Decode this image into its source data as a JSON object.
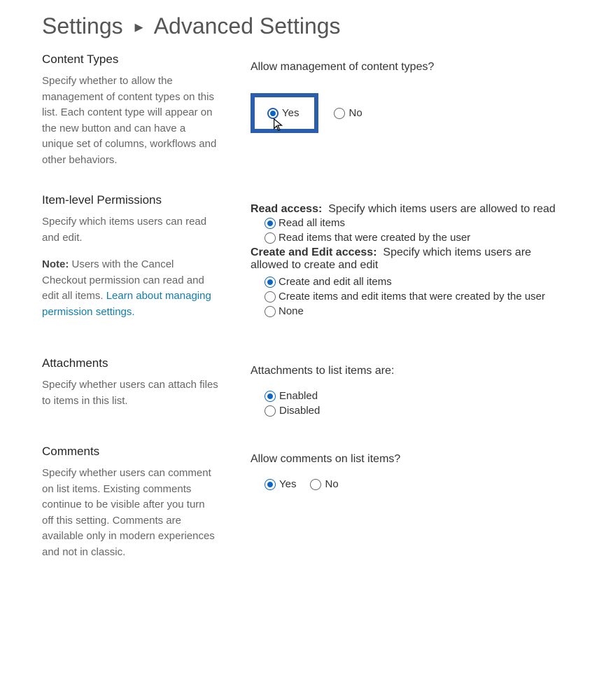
{
  "breadcrumb": {
    "root": "Settings",
    "current": "Advanced Settings"
  },
  "sections": {
    "content_types": {
      "title": "Content Types",
      "desc": "Specify whether to allow the management of content types on this list. Each content type will appear on the new button and can have a unique set of columns, workflows and other behaviors.",
      "question": "Allow management of content types?",
      "opt_yes": "Yes",
      "opt_no": "No"
    },
    "item_level": {
      "title": "Item-level Permissions",
      "desc_main": "Specify which items users can read and edit.",
      "note_label": "Note:",
      "note_text": " Users with the Cancel Checkout permission can read and edit all items. ",
      "link": "Learn about managing permission settings.",
      "read_label": "Read access:",
      "read_hint": "Specify which items users are allowed to read",
      "read_opt1": "Read all items",
      "read_opt2": "Read items that were created by the user",
      "edit_label": "Create and Edit access:",
      "edit_hint": "Specify which items users are allowed to create and edit",
      "edit_opt1": "Create and edit all items",
      "edit_opt2": "Create items and edit items that were created by the user",
      "edit_opt3": "None"
    },
    "attachments": {
      "title": "Attachments",
      "desc": "Specify whether users can attach files to items in this list.",
      "question": "Attachments to list items are:",
      "opt_enabled": "Enabled",
      "opt_disabled": "Disabled"
    },
    "comments": {
      "title": "Comments",
      "desc": "Specify whether users can comment on list items. Existing comments continue to be visible after you turn off this setting. Comments are available only in modern experiences and not in classic.",
      "question": "Allow comments on list items?",
      "opt_yes": "Yes",
      "opt_no": "No"
    }
  }
}
